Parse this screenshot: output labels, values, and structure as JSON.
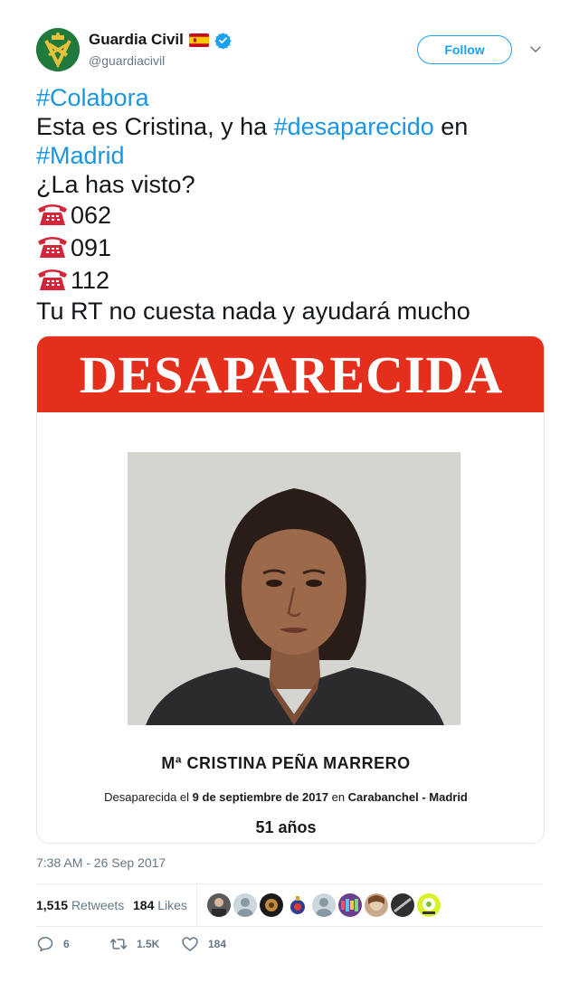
{
  "author": {
    "display_name": "Guardia Civil",
    "handle": "@guardiacivil",
    "avatar_icon": "guardia-civil-emblem",
    "flag_icon": "spain-flag-emoji",
    "verified_icon": "verified-badge",
    "avatar_color": "#1f7a3c"
  },
  "follow_button": {
    "label": "Follow"
  },
  "tweet": {
    "hashtag_colabora": "#Colabora",
    "line2_prefix": "Esta es Cristina, y ha ",
    "hashtag_desaparecido": "#desaparecido",
    "line2_suffix": " en",
    "hashtag_madrid": "#Madrid",
    "line4": "¿La has visto?",
    "phone_numbers": [
      "062",
      "091",
      "112"
    ],
    "phone_icon": "telephone-emoji",
    "line_last": "Tu RT no cuesta nada y ayudará mucho",
    "hashtag_color": "#1b95e0"
  },
  "poster": {
    "banner_text": "DESAPARECIDA",
    "banner_color": "#e42f1c",
    "person_name": "Mª CRISTINA PEÑA MARRERO",
    "missing_prefix": "Desaparecida el ",
    "missing_date": "9 de septiembre de 2017",
    "missing_middle": " en ",
    "missing_place": "Carabanchel - Madrid",
    "age": "51 años"
  },
  "timestamp": "7:38 AM - 26 Sep 2017",
  "stats": {
    "retweets_count": "1,515",
    "retweets_label": "Retweets",
    "likes_count": "184",
    "likes_label": "Likes"
  },
  "actions": {
    "reply_count": "6",
    "retweet_count": "1.5K",
    "like_count": "184"
  },
  "accent_color": "#1da1f2"
}
